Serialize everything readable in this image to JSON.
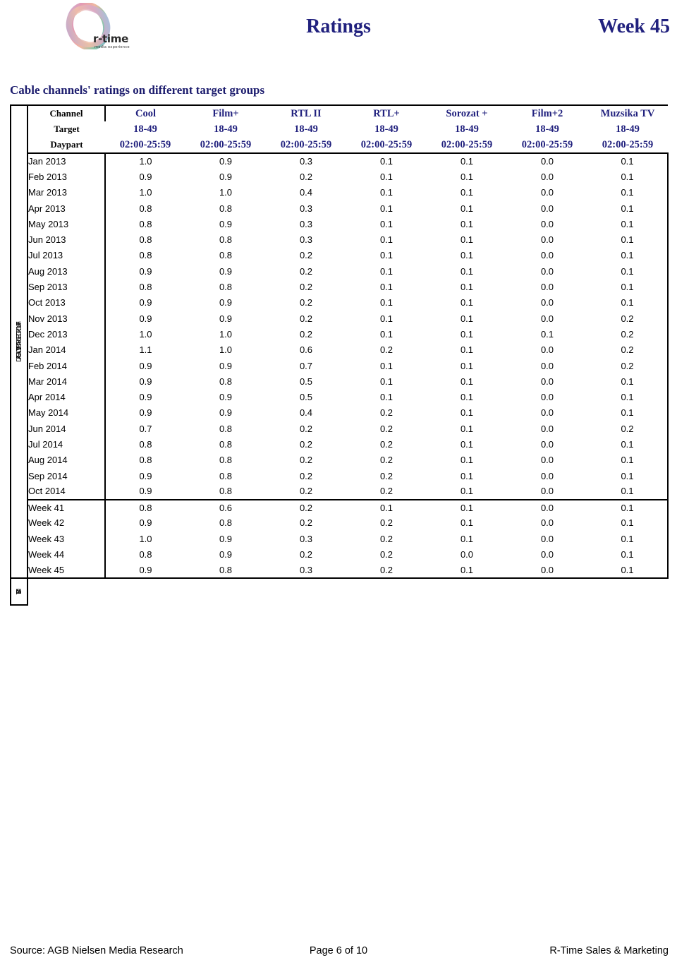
{
  "header": {
    "title": "Ratings",
    "week": "Week 45",
    "logo": {
      "name": "r-time",
      "tagline": "media experience"
    }
  },
  "section": {
    "title": "Cable channels' ratings on different target groups"
  },
  "spine": {
    "top_label": "GROUPPast",
    "top_label_full": "DATEACTIVITYTARGETGROUPPast",
    "mid_label": "DATEACTIVITYTARGETGROUP",
    "bottom_label": "TIBAS"
  },
  "table": {
    "row_header_labels": [
      "Channel",
      "Target",
      "Daypart"
    ],
    "channels": [
      "Cool",
      "Film+",
      "RTL II",
      "RTL+",
      "Sorozat +",
      "Film+2",
      "Muzsika TV"
    ],
    "targets": [
      "18-49",
      "18-49",
      "18-49",
      "18-49",
      "18-49",
      "18-49",
      "18-49"
    ],
    "dayparts": [
      "02:00-25:59",
      "02:00-25:59",
      "02:00-25:59",
      "02:00-25:59",
      "02:00-25:59",
      "02:00-25:59",
      "02:00-25:59"
    ],
    "monthly_rows": [
      {
        "period": "Jan 2013",
        "values": [
          "1.0",
          "0.9",
          "0.3",
          "0.1",
          "0.1",
          "0.0",
          "0.1"
        ]
      },
      {
        "period": "Feb 2013",
        "values": [
          "0.9",
          "0.9",
          "0.2",
          "0.1",
          "0.1",
          "0.0",
          "0.1"
        ]
      },
      {
        "period": "Mar 2013",
        "values": [
          "1.0",
          "1.0",
          "0.4",
          "0.1",
          "0.1",
          "0.0",
          "0.1"
        ]
      },
      {
        "period": "Apr 2013",
        "values": [
          "0.8",
          "0.8",
          "0.3",
          "0.1",
          "0.1",
          "0.0",
          "0.1"
        ]
      },
      {
        "period": "May 2013",
        "values": [
          "0.8",
          "0.9",
          "0.3",
          "0.1",
          "0.1",
          "0.0",
          "0.1"
        ]
      },
      {
        "period": "Jun 2013",
        "values": [
          "0.8",
          "0.8",
          "0.3",
          "0.1",
          "0.1",
          "0.0",
          "0.1"
        ]
      },
      {
        "period": "Jul 2013",
        "values": [
          "0.8",
          "0.8",
          "0.2",
          "0.1",
          "0.1",
          "0.0",
          "0.1"
        ]
      },
      {
        "period": "Aug 2013",
        "values": [
          "0.9",
          "0.9",
          "0.2",
          "0.1",
          "0.1",
          "0.0",
          "0.1"
        ]
      },
      {
        "period": "Sep 2013",
        "values": [
          "0.8",
          "0.8",
          "0.2",
          "0.1",
          "0.1",
          "0.0",
          "0.1"
        ]
      },
      {
        "period": "Oct 2013",
        "values": [
          "0.9",
          "0.9",
          "0.2",
          "0.1",
          "0.1",
          "0.0",
          "0.1"
        ]
      },
      {
        "period": "Nov 2013",
        "values": [
          "0.9",
          "0.9",
          "0.2",
          "0.1",
          "0.1",
          "0.0",
          "0.2"
        ]
      },
      {
        "period": "Dec 2013",
        "values": [
          "1.0",
          "1.0",
          "0.2",
          "0.1",
          "0.1",
          "0.1",
          "0.2"
        ]
      },
      {
        "period": "Jan 2014",
        "values": [
          "1.1",
          "1.0",
          "0.6",
          "0.2",
          "0.1",
          "0.0",
          "0.2"
        ]
      },
      {
        "period": "Feb 2014",
        "values": [
          "0.9",
          "0.9",
          "0.7",
          "0.1",
          "0.1",
          "0.0",
          "0.2"
        ]
      },
      {
        "period": "Mar 2014",
        "values": [
          "0.9",
          "0.8",
          "0.5",
          "0.1",
          "0.1",
          "0.0",
          "0.1"
        ]
      },
      {
        "period": "Apr 2014",
        "values": [
          "0.9",
          "0.9",
          "0.5",
          "0.1",
          "0.1",
          "0.0",
          "0.1"
        ]
      },
      {
        "period": "May 2014",
        "values": [
          "0.9",
          "0.9",
          "0.4",
          "0.2",
          "0.1",
          "0.0",
          "0.1"
        ]
      },
      {
        "period": "Jun 2014",
        "values": [
          "0.7",
          "0.8",
          "0.2",
          "0.2",
          "0.1",
          "0.0",
          "0.2"
        ]
      },
      {
        "period": "Jul 2014",
        "values": [
          "0.8",
          "0.8",
          "0.2",
          "0.2",
          "0.1",
          "0.0",
          "0.1"
        ]
      },
      {
        "period": "Aug 2014",
        "values": [
          "0.8",
          "0.8",
          "0.2",
          "0.2",
          "0.1",
          "0.0",
          "0.1"
        ]
      },
      {
        "period": "Sep 2014",
        "values": [
          "0.9",
          "0.8",
          "0.2",
          "0.2",
          "0.1",
          "0.0",
          "0.1"
        ]
      },
      {
        "period": "Oct 2014",
        "values": [
          "0.9",
          "0.8",
          "0.2",
          "0.2",
          "0.1",
          "0.0",
          "0.1"
        ]
      }
    ],
    "weekly_rows": [
      {
        "period": "Week 41",
        "values": [
          "0.8",
          "0.6",
          "0.2",
          "0.1",
          "0.1",
          "0.0",
          "0.1"
        ]
      },
      {
        "period": "Week 42",
        "values": [
          "0.9",
          "0.8",
          "0.2",
          "0.2",
          "0.1",
          "0.0",
          "0.1"
        ]
      },
      {
        "period": "Week 43",
        "values": [
          "1.0",
          "0.9",
          "0.3",
          "0.2",
          "0.1",
          "0.0",
          "0.1"
        ]
      },
      {
        "period": "Week 44",
        "values": [
          "0.8",
          "0.9",
          "0.2",
          "0.2",
          "0.0",
          "0.0",
          "0.1"
        ]
      },
      {
        "period": "Week 45",
        "values": [
          "0.9",
          "0.8",
          "0.3",
          "0.2",
          "0.1",
          "0.0",
          "0.1"
        ]
      }
    ]
  },
  "footer": {
    "source": "Source: AGB Nielsen Media Research",
    "page": "Page 6 of 10",
    "owner": "R-Time Sales & Marketing"
  },
  "colors": {
    "heading_blue": "#21217e",
    "text_black": "#000000",
    "rule": "#000000"
  },
  "chart_data": {
    "type": "table",
    "title": "Cable channels' ratings on different target groups",
    "columns": [
      "Cool",
      "Film+",
      "RTL II",
      "RTL+",
      "Sorozat +",
      "Film+2",
      "Muzsika TV"
    ],
    "target": "18-49",
    "daypart": "02:00-25:59",
    "categories": [
      "Jan 2013",
      "Feb 2013",
      "Mar 2013",
      "Apr 2013",
      "May 2013",
      "Jun 2013",
      "Jul 2013",
      "Aug 2013",
      "Sep 2013",
      "Oct 2013",
      "Nov 2013",
      "Dec 2013",
      "Jan 2014",
      "Feb 2014",
      "Mar 2014",
      "Apr 2014",
      "May 2014",
      "Jun 2014",
      "Jul 2014",
      "Aug 2014",
      "Sep 2014",
      "Oct 2014",
      "Week 41",
      "Week 42",
      "Week 43",
      "Week 44",
      "Week 45"
    ],
    "series": [
      {
        "name": "Cool",
        "values": [
          1.0,
          0.9,
          1.0,
          0.8,
          0.8,
          0.8,
          0.8,
          0.9,
          0.8,
          0.9,
          0.9,
          1.0,
          1.1,
          0.9,
          0.9,
          0.9,
          0.9,
          0.7,
          0.8,
          0.8,
          0.9,
          0.9,
          0.8,
          0.9,
          1.0,
          0.8,
          0.9
        ]
      },
      {
        "name": "Film+",
        "values": [
          0.9,
          0.9,
          1.0,
          0.8,
          0.9,
          0.8,
          0.8,
          0.9,
          0.8,
          0.9,
          0.9,
          1.0,
          1.0,
          0.9,
          0.8,
          0.9,
          0.9,
          0.8,
          0.8,
          0.8,
          0.8,
          0.8,
          0.6,
          0.8,
          0.9,
          0.9,
          0.8
        ]
      },
      {
        "name": "RTL II",
        "values": [
          0.3,
          0.2,
          0.4,
          0.3,
          0.3,
          0.3,
          0.2,
          0.2,
          0.2,
          0.2,
          0.2,
          0.2,
          0.6,
          0.7,
          0.5,
          0.5,
          0.4,
          0.2,
          0.2,
          0.2,
          0.2,
          0.2,
          0.2,
          0.2,
          0.3,
          0.2,
          0.3
        ]
      },
      {
        "name": "RTL+",
        "values": [
          0.1,
          0.1,
          0.1,
          0.1,
          0.1,
          0.1,
          0.1,
          0.1,
          0.1,
          0.1,
          0.1,
          0.1,
          0.2,
          0.1,
          0.1,
          0.1,
          0.2,
          0.2,
          0.2,
          0.2,
          0.2,
          0.2,
          0.1,
          0.2,
          0.2,
          0.2,
          0.2
        ]
      },
      {
        "name": "Sorozat +",
        "values": [
          0.1,
          0.1,
          0.1,
          0.1,
          0.1,
          0.1,
          0.1,
          0.1,
          0.1,
          0.1,
          0.1,
          0.1,
          0.1,
          0.1,
          0.1,
          0.1,
          0.1,
          0.1,
          0.1,
          0.1,
          0.1,
          0.1,
          0.1,
          0.1,
          0.1,
          0.0,
          0.1
        ]
      },
      {
        "name": "Film+2",
        "values": [
          0.0,
          0.0,
          0.0,
          0.0,
          0.0,
          0.0,
          0.0,
          0.0,
          0.0,
          0.0,
          0.0,
          0.1,
          0.0,
          0.0,
          0.0,
          0.0,
          0.0,
          0.0,
          0.0,
          0.0,
          0.0,
          0.0,
          0.0,
          0.0,
          0.0,
          0.0,
          0.0
        ]
      },
      {
        "name": "Muzsika TV",
        "values": [
          0.1,
          0.1,
          0.1,
          0.1,
          0.1,
          0.1,
          0.1,
          0.1,
          0.1,
          0.1,
          0.2,
          0.2,
          0.2,
          0.2,
          0.1,
          0.1,
          0.1,
          0.2,
          0.1,
          0.1,
          0.1,
          0.1,
          0.1,
          0.1,
          0.1,
          0.1,
          0.1
        ]
      }
    ]
  }
}
